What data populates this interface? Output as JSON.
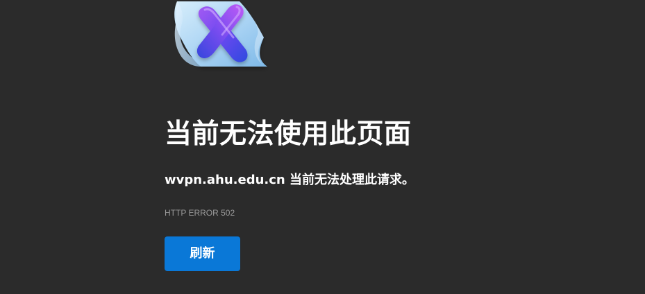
{
  "error": {
    "illustration_icon": "document-error-x-icon",
    "title": "当前无法使用此页面",
    "message": "wvpn.ahu.edu.cn 当前无法处理此请求。",
    "code": "HTTP ERROR 502",
    "reload_label": "刷新"
  },
  "colors": {
    "background": "#2b2b2b",
    "text": "#ffffff",
    "secondary_text": "#9a9a9a",
    "button": "#0a78d7"
  }
}
